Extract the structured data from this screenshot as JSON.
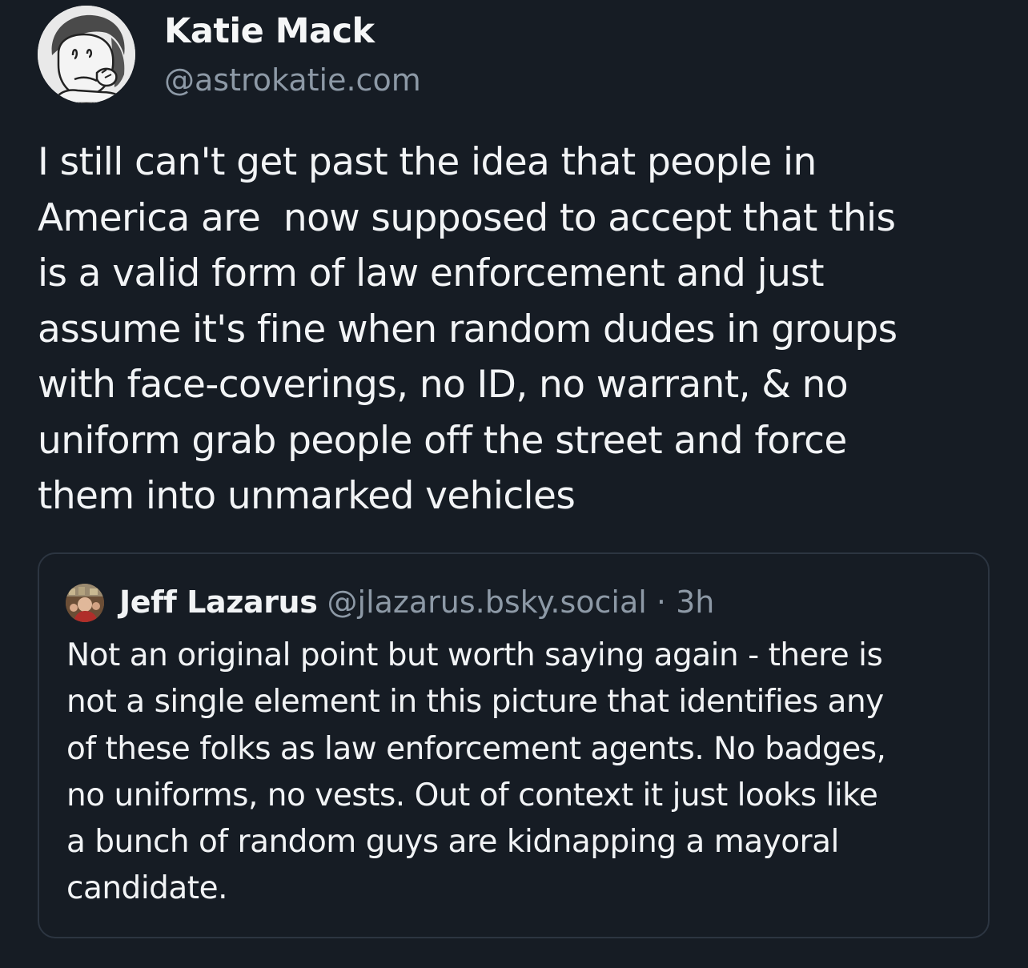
{
  "post": {
    "author": {
      "name": "Katie Mack",
      "handle": "@astrokatie.com",
      "avatar": "cartoon-portrait-avatar"
    },
    "text_lines": [
      "I still can't get past the idea that people in",
      "America are  now supposed to accept that this",
      "is a valid form of law enforcement and just",
      "assume it's fine when random dudes in groups",
      "with face-coverings, no ID, no warrant, & no",
      "uniform grab people off the street and force",
      "them into unmarked vehicles"
    ]
  },
  "quoted_post": {
    "author": {
      "name": "Jeff Lazarus",
      "handle": "@jlazarus.bsky.social",
      "separator": "·",
      "time": "3h",
      "avatar": "photo-avatar"
    },
    "text_lines": [
      "Not an original point but worth saying again - there is",
      "not a single element in this picture that identifies any",
      "of these folks as law enforcement agents. No badges,",
      "no uniforms, no vests. Out of context it just looks like",
      "a bunch of random guys are kidnapping a mayoral",
      "candidate."
    ]
  },
  "colors": {
    "background": "#161c24",
    "text_primary": "#f1f3f5",
    "text_secondary": "#8d99a6",
    "card_border": "#2c3541"
  }
}
